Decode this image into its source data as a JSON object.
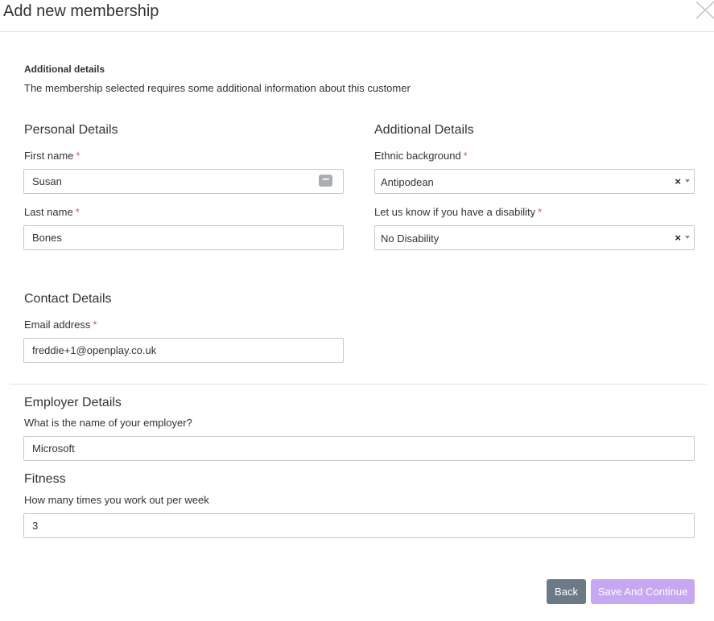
{
  "modal": {
    "title": "Add new membership"
  },
  "intro": {
    "heading": "Additional details",
    "description": "The membership selected requires some additional information about this customer"
  },
  "personal": {
    "title": "Personal Details",
    "first_name_label": "First name",
    "first_name_value": "Susan",
    "last_name_label": "Last name",
    "last_name_value": "Bones"
  },
  "additional": {
    "title": "Additional Details",
    "ethnic_label": "Ethnic background",
    "ethnic_value": "Antipodean",
    "disability_label": "Let us know if you have a disability",
    "disability_value": "No Disability",
    "clear_glyph": "×"
  },
  "contact": {
    "title": "Contact Details",
    "email_label": "Email address",
    "email_value": "freddie+1@openplay.co.uk"
  },
  "employer": {
    "title": "Employer Details",
    "question": "What is the name of your employer?",
    "value": "Microsoft"
  },
  "fitness": {
    "title": "Fitness",
    "question": "How many times you work out per week",
    "value": "3"
  },
  "required_marker": "*",
  "buttons": {
    "back": "Back",
    "save": "Save And Continue"
  },
  "colors": {
    "required": "#e05555",
    "back_button": "#6c7a87",
    "save_button_disabled": "#c6a8f2"
  }
}
